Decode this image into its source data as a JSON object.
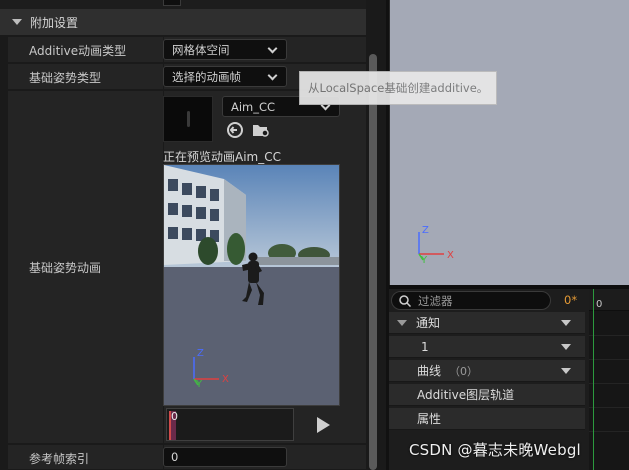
{
  "details": {
    "section_title": "附加设置",
    "rows": [
      {
        "label": "Additive动画类型",
        "value": "网格体空间"
      },
      {
        "label": "基础姿势类型",
        "value": "选择的动画帧"
      },
      {
        "label": "基础姿势动画"
      },
      {
        "label": "参考帧索引",
        "value": "0"
      }
    ],
    "asset_name": "Aim_CC",
    "preview_text": "正在预览动画Aim_CC",
    "timeline_frame": "0",
    "tooltip": "从LocalSpace基础创建additive。"
  },
  "viewport_axes": {
    "x": "X",
    "y": "Y",
    "z": "Z"
  },
  "track_panel": {
    "filter_placeholder": "过滤器",
    "filter_count": "0*",
    "tracks": [
      {
        "label": "通知"
      },
      {
        "label": "1"
      },
      {
        "label": "曲线",
        "count": "（0）"
      },
      {
        "label": "Additive图层轨道"
      },
      {
        "label": "属性"
      }
    ],
    "timeline_zero": "0"
  },
  "watermark": "CSDN @暮志未晚Webgl",
  "colors": {
    "accent_orange": "#e59a35",
    "timeline_green": "#2c9a3e",
    "axis_x": "#e04040",
    "axis_y": "#40c040",
    "axis_z": "#4a6cff"
  }
}
